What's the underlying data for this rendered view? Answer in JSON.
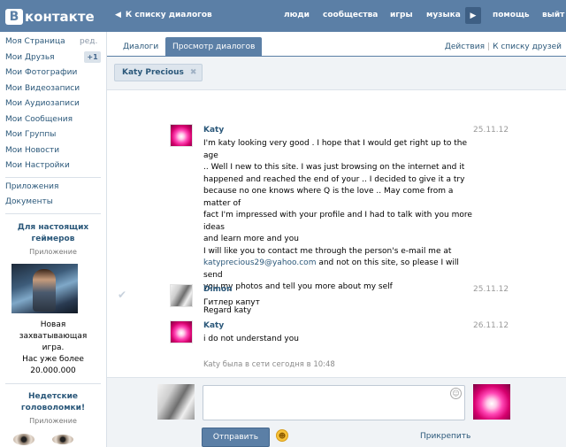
{
  "header": {
    "logo_letter": "В",
    "logo_text": "контакте",
    "back_link": "К списку диалогов",
    "nav": [
      "люди",
      "сообщества",
      "игры",
      "музыка",
      "помощь",
      "выйт"
    ]
  },
  "sidebar": {
    "items": [
      "Моя Страница",
      "Мои Друзья",
      "Мои Фотографии",
      "Мои Видеозаписи",
      "Мои Аудиозаписи",
      "Мои Сообщения",
      "Мои Группы",
      "Мои Новости",
      "Мои Настройки"
    ],
    "edit_label": "ред.",
    "friends_badge": "+1",
    "extra": [
      "Приложения",
      "Документы"
    ],
    "ads": [
      {
        "title_line1": "Для настоящих",
        "title_line2": "геймеров",
        "subtitle": "Приложение",
        "text_lines": [
          "Новая",
          "захватывающая",
          "игра.",
          "Нас уже более",
          "20.000.000"
        ]
      },
      {
        "title_line1": "Недетские",
        "title_line2": "головоломки!",
        "subtitle": "Приложение"
      }
    ]
  },
  "tabs": {
    "dialogs": "Диалоги",
    "view": "Просмотр диалогов",
    "actions": "Действия",
    "friends_list": "К списку друзей"
  },
  "chip": {
    "label": "Katy Precious",
    "close": "✖"
  },
  "messages": [
    {
      "author": "Katy",
      "date": "25.11.12",
      "lines": [
        "I'm katy looking very good . I hope that I would get right up to the age",
        ".. Well I new to this site. I was just browsing on the internet and it",
        "happened and reached the end of your .. I decided to give it a try",
        "because no one knows where Q is the love .. May come from a matter of",
        "fact I'm impressed with your profile and I had to talk with you more ideas",
        "and learn more and you",
        "I will like you to contact me through the person's e-mail me at"
      ],
      "email": "katyprecious29@yahoo.com",
      "after_email": " and not on this site, so please I will send",
      "line_after": "you my photos and tell you more about my self",
      "signoff": "Regard katy"
    },
    {
      "author": "Dimon",
      "date": "25.11.12",
      "text": "Гитлер капут"
    },
    {
      "author": "Katy",
      "date": "26.11.12",
      "text": "i do not understand you"
    }
  ],
  "online_status": "Katy была в сети сегодня в 10:48",
  "compose": {
    "input_value": "",
    "send_label": "Отправить",
    "attach_label": "Прикрепить"
  },
  "icons": {
    "play": "play-icon",
    "close": "close-icon",
    "check": "check-icon",
    "smile": "smile-icon",
    "emoji": "emoji-icon"
  },
  "colors": {
    "brand": "#5b7fa6",
    "link": "#2b587a",
    "panel": "#f0f3f6"
  }
}
